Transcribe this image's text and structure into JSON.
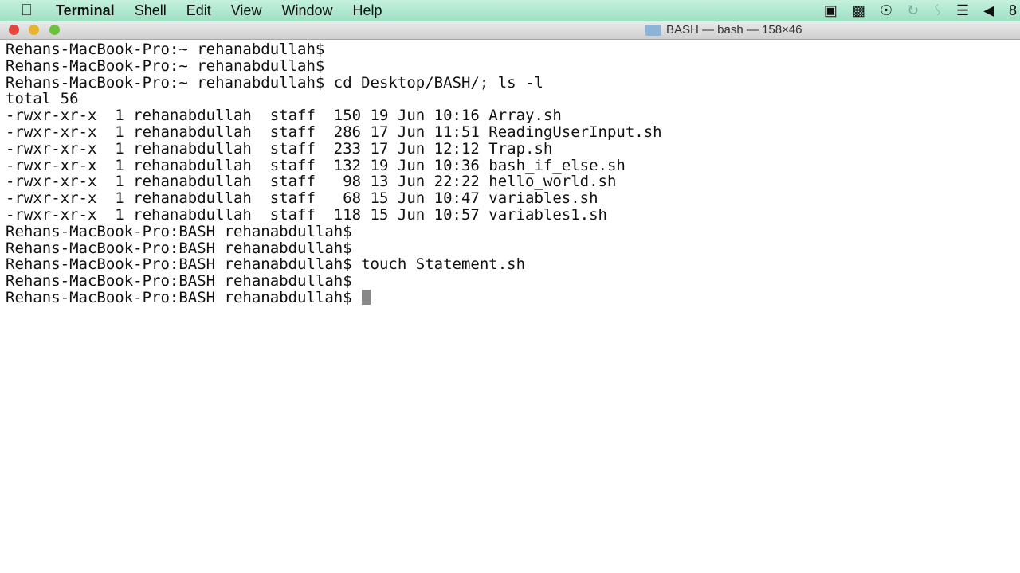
{
  "menubar": {
    "app": "Terminal",
    "items": [
      "Shell",
      "Edit",
      "View",
      "Window",
      "Help"
    ],
    "status_icons": [
      "video-camera-icon",
      "display-icon",
      "accessibility-icon",
      "time-machine-icon",
      "bluetooth-icon",
      "wifi-icon",
      "volume-icon"
    ],
    "clock_fragment": "8"
  },
  "window": {
    "title": "BASH — bash — 158×46"
  },
  "terminal": {
    "lines": [
      "Rehans-MacBook-Pro:~ rehanabdullah$",
      "Rehans-MacBook-Pro:~ rehanabdullah$",
      "Rehans-MacBook-Pro:~ rehanabdullah$ cd Desktop/BASH/; ls -l",
      "total 56",
      "-rwxr-xr-x  1 rehanabdullah  staff  150 19 Jun 10:16 Array.sh",
      "-rwxr-xr-x  1 rehanabdullah  staff  286 17 Jun 11:51 ReadingUserInput.sh",
      "-rwxr-xr-x  1 rehanabdullah  staff  233 17 Jun 12:12 Trap.sh",
      "-rwxr-xr-x  1 rehanabdullah  staff  132 19 Jun 10:36 bash_if_else.sh",
      "-rwxr-xr-x  1 rehanabdullah  staff   98 13 Jun 22:22 hello_world.sh",
      "-rwxr-xr-x  1 rehanabdullah  staff   68 15 Jun 10:47 variables.sh",
      "-rwxr-xr-x  1 rehanabdullah  staff  118 15 Jun 10:57 variables1.sh",
      "Rehans-MacBook-Pro:BASH rehanabdullah$",
      "Rehans-MacBook-Pro:BASH rehanabdullah$",
      "Rehans-MacBook-Pro:BASH rehanabdullah$ touch Statement.sh",
      "Rehans-MacBook-Pro:BASH rehanabdullah$"
    ],
    "prompt": "Rehans-MacBook-Pro:BASH rehanabdullah$ "
  }
}
